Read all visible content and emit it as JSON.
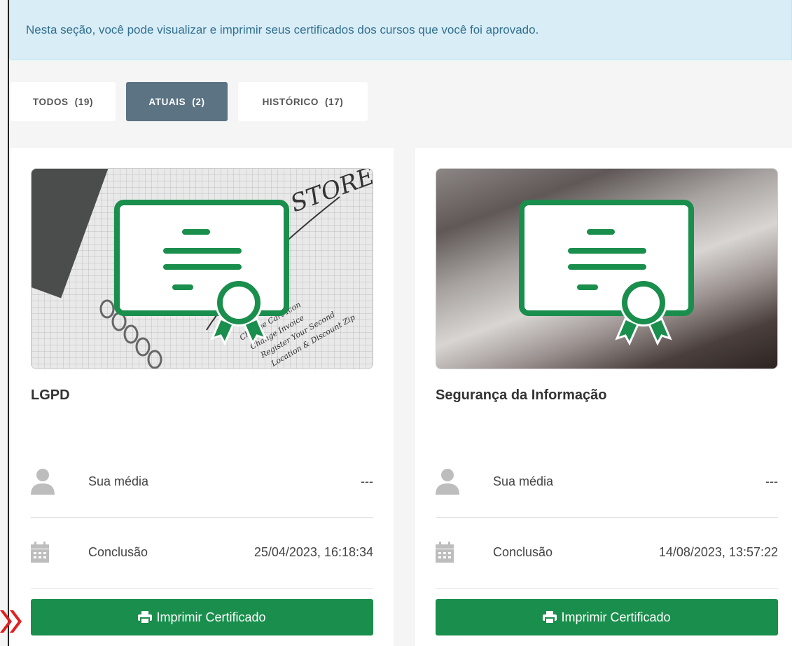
{
  "banner": {
    "text": "Nesta seção, você pode visualizar e imprimir seus certificados dos cursos que você foi aprovado."
  },
  "tabs": [
    {
      "label": "TODOS",
      "count": "(19)",
      "active": false
    },
    {
      "label": "ATUAIS",
      "count": "(2)",
      "active": true
    },
    {
      "label": "HISTÓRICO",
      "count": "(17)",
      "active": false
    }
  ],
  "cards": [
    {
      "title": "LGPD",
      "average_label": "Sua média",
      "average_value": "---",
      "conclusion_label": "Conclusão",
      "conclusion_value": "25/04/2023, 16:18:34",
      "print_label": "Imprimir Certificado",
      "thumbnail_text": [
        "STORE",
        "Change Cart Icon",
        "Change Invoice",
        "Register Your Second",
        "Location & Discount Zip"
      ]
    },
    {
      "title": "Segurança da Informação",
      "average_label": "Sua média",
      "average_value": "---",
      "conclusion_label": "Conclusão",
      "conclusion_value": "14/08/2023, 13:57:22",
      "print_label": "Imprimir Certificado"
    }
  ],
  "colors": {
    "banner_bg": "#d9edf7",
    "banner_text": "#31708f",
    "tab_active": "#5b7383",
    "button": "#1a8e4c",
    "certificate_icon": "#1a8e4c",
    "marker": "#e02020"
  },
  "icons": [
    "user-icon",
    "calendar-icon",
    "print-icon",
    "certificate-icon",
    "double-chevron-right-icon"
  ]
}
